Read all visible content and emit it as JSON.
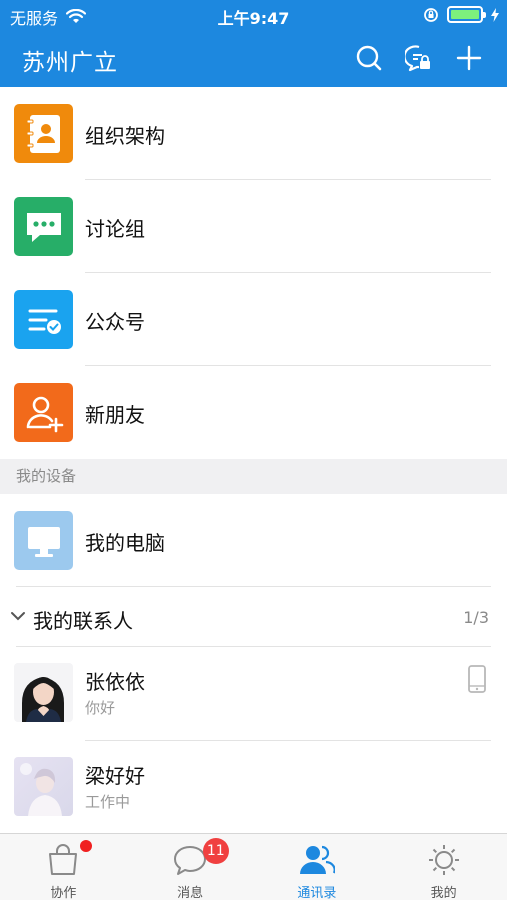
{
  "status_bar": {
    "carrier": "无服务",
    "time": "上午9:47"
  },
  "nav": {
    "title": "苏州广立",
    "icons": [
      "search-icon",
      "chat-lock-icon",
      "add-icon"
    ]
  },
  "entries": [
    {
      "label": "组织架构",
      "icon": "org-book-icon",
      "color": "#f08a0c"
    },
    {
      "label": "讨论组",
      "icon": "chat-bubble-icon",
      "color": "#27ae68"
    },
    {
      "label": "公众号",
      "icon": "list-check-icon",
      "color": "#1aa3ef"
    },
    {
      "label": "新朋友",
      "icon": "add-friend-icon",
      "color": "#f26a1b"
    }
  ],
  "devices": {
    "header": "我的设备",
    "items": [
      {
        "label": "我的电脑",
        "icon": "monitor-icon",
        "color": "#9cc9ee"
      }
    ]
  },
  "contacts": {
    "header": "我的联系人",
    "count": "1/3",
    "items": [
      {
        "name": "张依依",
        "status": "你好"
      },
      {
        "name": "梁好好",
        "status": "工作中"
      }
    ]
  },
  "tabs": [
    {
      "label": "协作",
      "icon": "bag-icon"
    },
    {
      "label": "消息",
      "icon": "message-icon",
      "badge": "11"
    },
    {
      "label": "通讯录",
      "icon": "contacts-icon",
      "active": true
    },
    {
      "label": "我的",
      "icon": "settings-icon"
    }
  ],
  "colors": {
    "accent": "#1d88df",
    "badge": "#f04040"
  }
}
